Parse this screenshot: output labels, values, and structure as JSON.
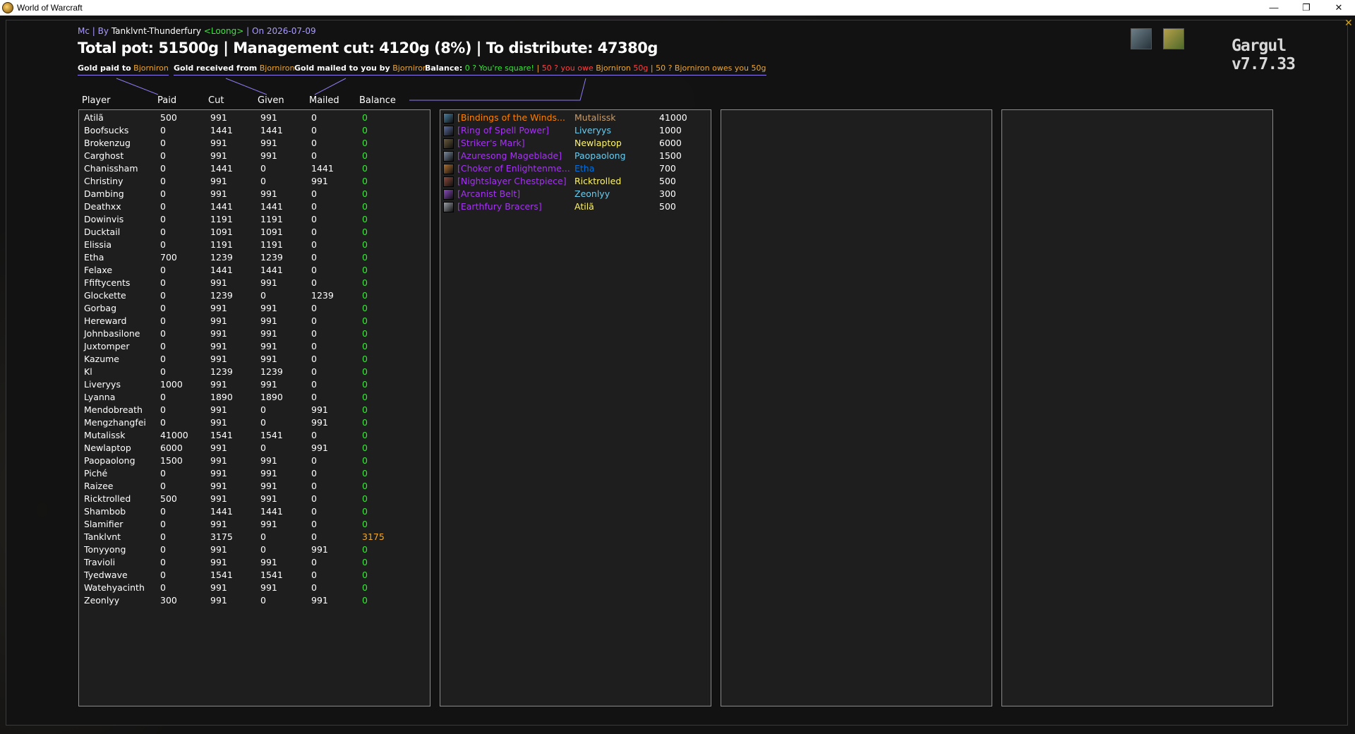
{
  "window": {
    "title": "World of Warcraft",
    "minimize": "—",
    "maximize": "❐",
    "close": "✕"
  },
  "addon": {
    "brand": "Gargul v7.7.33",
    "close": "✕"
  },
  "header": {
    "instance": "Mc",
    "by_label": "| By",
    "author": "Tanklvnt-Thunderfury",
    "guild": "<Loong>",
    "date_label": "| On 2026-07-09",
    "title": "Total pot: 51500g | Management cut: 4120g (8%) | To distribute: 47380g"
  },
  "legend": {
    "paid_label": "Gold paid to",
    "received_label": "Gold received from",
    "mailed_label": "Gold mailed to you by",
    "name": "Bjorniron",
    "balance_label": "Balance:",
    "square_text": "0 ? You're square!",
    "sep": "|",
    "owe_text": "50 ? you owe",
    "owe_amount": "50g",
    "owes_text": "50 ? Bjorniron owes you 50g"
  },
  "columns": {
    "player": "Player",
    "paid": "Paid",
    "cut": "Cut",
    "given": "Given",
    "mailed": "Mailed",
    "balance": "Balance"
  },
  "players": [
    {
      "name": "Atilã",
      "paid": "500",
      "cut": "991",
      "given": "991",
      "mailed": "0",
      "balance": "0"
    },
    {
      "name": "Boofsucks",
      "paid": "0",
      "cut": "1441",
      "given": "1441",
      "mailed": "0",
      "balance": "0"
    },
    {
      "name": "Brokenzug",
      "paid": "0",
      "cut": "991",
      "given": "991",
      "mailed": "0",
      "balance": "0"
    },
    {
      "name": "Carghost",
      "paid": "0",
      "cut": "991",
      "given": "991",
      "mailed": "0",
      "balance": "0"
    },
    {
      "name": "Chanissham",
      "paid": "0",
      "cut": "1441",
      "given": "0",
      "mailed": "1441",
      "balance": "0"
    },
    {
      "name": "Christiny",
      "paid": "0",
      "cut": "991",
      "given": "0",
      "mailed": "991",
      "balance": "0"
    },
    {
      "name": "Dambing",
      "paid": "0",
      "cut": "991",
      "given": "991",
      "mailed": "0",
      "balance": "0"
    },
    {
      "name": "Deathxx",
      "paid": "0",
      "cut": "1441",
      "given": "1441",
      "mailed": "0",
      "balance": "0"
    },
    {
      "name": "Dowinvis",
      "paid": "0",
      "cut": "1191",
      "given": "1191",
      "mailed": "0",
      "balance": "0"
    },
    {
      "name": "Ducktail",
      "paid": "0",
      "cut": "1091",
      "given": "1091",
      "mailed": "0",
      "balance": "0"
    },
    {
      "name": "Elissia",
      "paid": "0",
      "cut": "1191",
      "given": "1191",
      "mailed": "0",
      "balance": "0"
    },
    {
      "name": "Etha",
      "paid": "700",
      "cut": "1239",
      "given": "1239",
      "mailed": "0",
      "balance": "0"
    },
    {
      "name": "Felaxe",
      "paid": "0",
      "cut": "1441",
      "given": "1441",
      "mailed": "0",
      "balance": "0"
    },
    {
      "name": "Ffiftycents",
      "paid": "0",
      "cut": "991",
      "given": "991",
      "mailed": "0",
      "balance": "0"
    },
    {
      "name": "Glockette",
      "paid": "0",
      "cut": "1239",
      "given": "0",
      "mailed": "1239",
      "balance": "0"
    },
    {
      "name": "Gorbag",
      "paid": "0",
      "cut": "991",
      "given": "991",
      "mailed": "0",
      "balance": "0"
    },
    {
      "name": "Hereward",
      "paid": "0",
      "cut": "991",
      "given": "991",
      "mailed": "0",
      "balance": "0"
    },
    {
      "name": "Johnbasilone",
      "paid": "0",
      "cut": "991",
      "given": "991",
      "mailed": "0",
      "balance": "0"
    },
    {
      "name": "Juxtomper",
      "paid": "0",
      "cut": "991",
      "given": "991",
      "mailed": "0",
      "balance": "0"
    },
    {
      "name": "Kazume",
      "paid": "0",
      "cut": "991",
      "given": "991",
      "mailed": "0",
      "balance": "0"
    },
    {
      "name": "Kl",
      "paid": "0",
      "cut": "1239",
      "given": "1239",
      "mailed": "0",
      "balance": "0"
    },
    {
      "name": "Liveryys",
      "paid": "1000",
      "cut": "991",
      "given": "991",
      "mailed": "0",
      "balance": "0"
    },
    {
      "name": "Lyanna",
      "paid": "0",
      "cut": "1890",
      "given": "1890",
      "mailed": "0",
      "balance": "0"
    },
    {
      "name": "Mendobreath",
      "paid": "0",
      "cut": "991",
      "given": "0",
      "mailed": "991",
      "balance": "0"
    },
    {
      "name": "Mengzhangfei",
      "paid": "0",
      "cut": "991",
      "given": "0",
      "mailed": "991",
      "balance": "0"
    },
    {
      "name": "Mutalissk",
      "paid": "41000",
      "cut": "1541",
      "given": "1541",
      "mailed": "0",
      "balance": "0"
    },
    {
      "name": "Newlaptop",
      "paid": "6000",
      "cut": "991",
      "given": "0",
      "mailed": "991",
      "balance": "0"
    },
    {
      "name": "Paopaolong",
      "paid": "1500",
      "cut": "991",
      "given": "991",
      "mailed": "0",
      "balance": "0"
    },
    {
      "name": "Piché",
      "paid": "0",
      "cut": "991",
      "given": "991",
      "mailed": "0",
      "balance": "0"
    },
    {
      "name": "Raizee",
      "paid": "0",
      "cut": "991",
      "given": "991",
      "mailed": "0",
      "balance": "0"
    },
    {
      "name": "Ricktrolled",
      "paid": "500",
      "cut": "991",
      "given": "991",
      "mailed": "0",
      "balance": "0"
    },
    {
      "name": "Shambob",
      "paid": "0",
      "cut": "1441",
      "given": "1441",
      "mailed": "0",
      "balance": "0"
    },
    {
      "name": "Slamifier",
      "paid": "0",
      "cut": "991",
      "given": "991",
      "mailed": "0",
      "balance": "0"
    },
    {
      "name": "Tanklvnt",
      "paid": "0",
      "cut": "3175",
      "given": "0",
      "mailed": "0",
      "balance": "3175"
    },
    {
      "name": "Tonyyong",
      "paid": "0",
      "cut": "991",
      "given": "0",
      "mailed": "991",
      "balance": "0"
    },
    {
      "name": "Travioli",
      "paid": "0",
      "cut": "991",
      "given": "991",
      "mailed": "0",
      "balance": "0"
    },
    {
      "name": "Tyedwave",
      "paid": "0",
      "cut": "1541",
      "given": "1541",
      "mailed": "0",
      "balance": "0"
    },
    {
      "name": "Watehyacinth",
      "paid": "0",
      "cut": "991",
      "given": "991",
      "mailed": "0",
      "balance": "0"
    },
    {
      "name": "Zeonlyy",
      "paid": "300",
      "cut": "991",
      "given": "0",
      "mailed": "991",
      "balance": "0"
    }
  ],
  "loot": [
    {
      "item": "[Bindings of the Winds...",
      "quality": "legendary",
      "winner": "Mutalissk",
      "winner_class": "warrior",
      "price": "41000",
      "icon_color": "#4a7fa0",
      "icon": "bracer-icon"
    },
    {
      "item": "[Ring of Spell Power]",
      "quality": "epic",
      "winner": "Liveryys",
      "winner_class": "mage",
      "price": "1000",
      "icon_color": "#5a6a9a",
      "icon": "ring-icon"
    },
    {
      "item": "[Striker's Mark]",
      "quality": "epic",
      "winner": "Newlaptop",
      "winner_class": "rogue",
      "price": "6000",
      "icon_color": "#6a5a3a",
      "icon": "bow-icon"
    },
    {
      "item": "[Azuresong Mageblade]",
      "quality": "epic",
      "winner": "Paopaolong",
      "winner_class": "mage",
      "price": "1500",
      "icon_color": "#7a8aa0",
      "icon": "sword-icon"
    },
    {
      "item": "[Choker of Enlightenme...",
      "quality": "epic",
      "winner": "Etha",
      "winner_class": "shaman",
      "price": "700",
      "icon_color": "#b07030",
      "icon": "necklace-icon"
    },
    {
      "item": "[Nightslayer Chestpiece]",
      "quality": "epic",
      "winner": "Ricktrolled",
      "winner_class": "rogue",
      "price": "500",
      "icon_color": "#8a4a3a",
      "icon": "chest-icon"
    },
    {
      "item": "[Arcanist Belt]",
      "quality": "epic",
      "winner": "Zeonlyy",
      "winner_class": "mage",
      "price": "300",
      "icon_color": "#8a4ac0",
      "icon": "belt-icon"
    },
    {
      "item": "[Earthfury Bracers]",
      "quality": "epic",
      "winner": "Atilã",
      "winner_class": "rogue",
      "price": "500",
      "icon_color": "#9aa0a8",
      "icon": "bracer-icon"
    }
  ]
}
